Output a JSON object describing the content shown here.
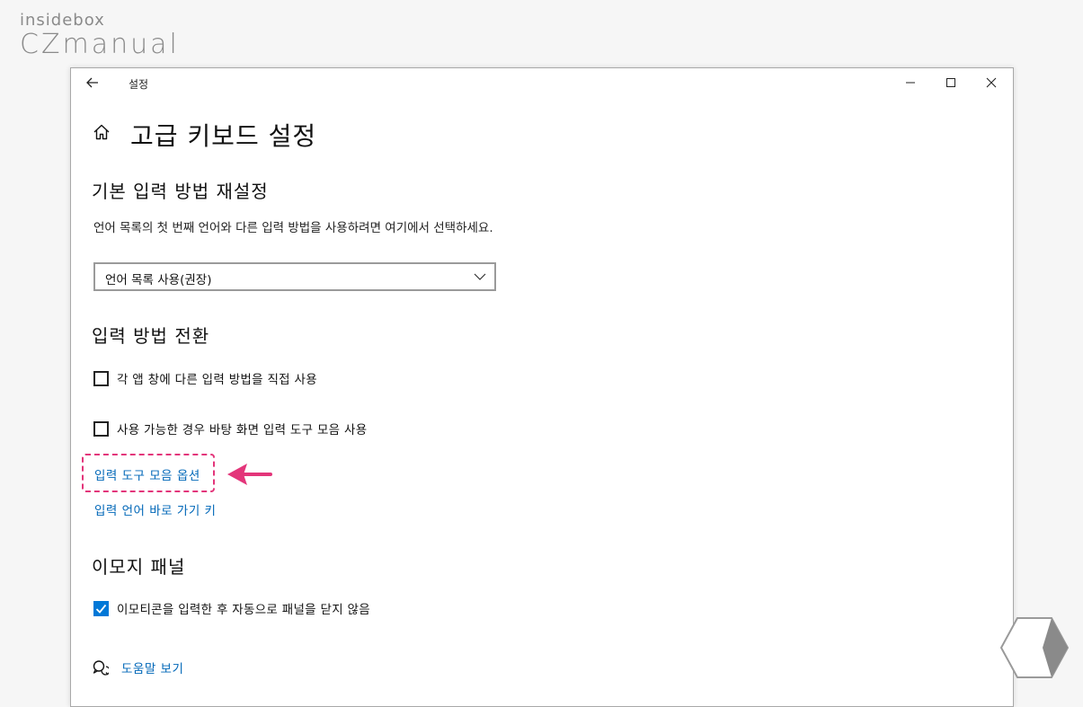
{
  "watermark": {
    "top": "insidebox",
    "bottom": "CZmanual"
  },
  "window": {
    "title": "설정",
    "page_title": "고급 키보드 설정"
  },
  "section_override": {
    "heading": "기본 입력 방법 재설정",
    "description": "언어 목록의 첫 번째 언어와 다른 입력 방법을 사용하려면 여기에서 선택하세요.",
    "dropdown_value": "언어 목록 사용(권장)"
  },
  "section_switch": {
    "heading": "입력 방법 전환",
    "checkbox1": {
      "label": "각 앱 창에 다른 입력 방법을 직접 사용",
      "checked": false
    },
    "checkbox2": {
      "label": "사용 가능한 경우 바탕 화면 입력 도구 모음 사용",
      "checked": false
    },
    "link_toolbar_options": "입력 도구 모음 옵션",
    "link_hotkeys": "입력 언어 바로 가기 키"
  },
  "section_emoji": {
    "heading": "이모지 패널",
    "checkbox": {
      "label": "이모티콘을 입력한 후 자동으로 패널을 닫지 않음",
      "checked": true
    }
  },
  "help": {
    "label": "도움말 보기"
  },
  "colors": {
    "accent": "#0078d7",
    "link": "#0067b8",
    "highlight": "#e3357a"
  }
}
